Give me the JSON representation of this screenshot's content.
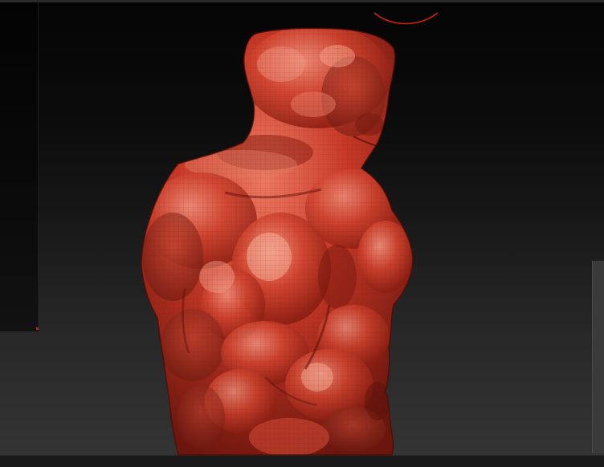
{
  "viewport": {
    "mesh_color": "#c83a2a",
    "mesh_shadow_color": "#6e1810",
    "mesh_highlight_color": "#f08a78",
    "background_top": "#050505",
    "background_bottom": "#343434",
    "cursor_ring_color": "#d21e14"
  },
  "icons": {
    "brush_cursor": "brush-cursor-icon"
  }
}
